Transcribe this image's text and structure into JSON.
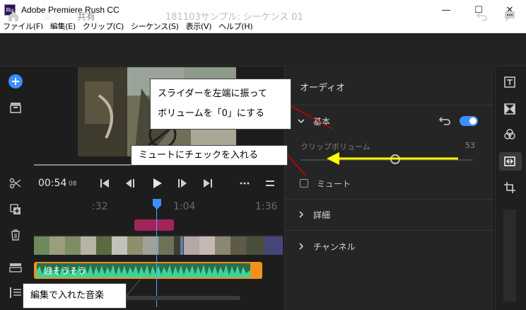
{
  "window": {
    "title": "Adobe Premiere Rush CC",
    "app_badge": "Ru",
    "minimize": "—",
    "maximize": "☐",
    "close": "✕"
  },
  "menu": [
    "ファイル(F)",
    "編集(E)",
    "クリップ(C)",
    "シーケンス(S)",
    "表示(V)",
    "ヘルプ(H)"
  ],
  "header": {
    "tab_edit": "編集",
    "tab_share": "共有",
    "project_title": "181103サンプル: シーケンス 01"
  },
  "transport": {
    "timecode": "00:54",
    "frames": "08"
  },
  "timeline": {
    "ticks": [
      ":32",
      "1:04",
      "1:36"
    ],
    "audio_clip_name": "涙そうそう"
  },
  "audio_panel": {
    "title": "オーディオ",
    "basic_label": "基本",
    "clip_volume_label": "クリップボリューム",
    "clip_volume_value": "53",
    "mute_label": "ミュート",
    "detail_label": "詳細",
    "channel_label": "チャンネル",
    "toggle_on": true
  },
  "annotations": {
    "slider_callout_line1": "スライダーを左端に振って",
    "slider_callout_line2": "ボリュームを「0」にする",
    "mute_callout": "ミュートにチェックを入れる",
    "music_callout": "編集で入れた音楽"
  },
  "colors": {
    "accent_blue": "#3f8eff",
    "audio_orange": "#f0921d",
    "waveform_green": "#3fd39a",
    "marker_pink": "#a0265a",
    "arrow_yellow": "#ffff00",
    "arrow_red": "#d00000"
  },
  "icons": {
    "home": "home-icon",
    "undo": "undo-icon",
    "chat": "chat-icon",
    "add": "add-icon",
    "media": "media-icon",
    "split": "scissors-icon",
    "duplicate": "duplicate-icon",
    "delete": "trash-icon",
    "track_toggle": "track-icon",
    "track_list": "track-list-icon"
  }
}
